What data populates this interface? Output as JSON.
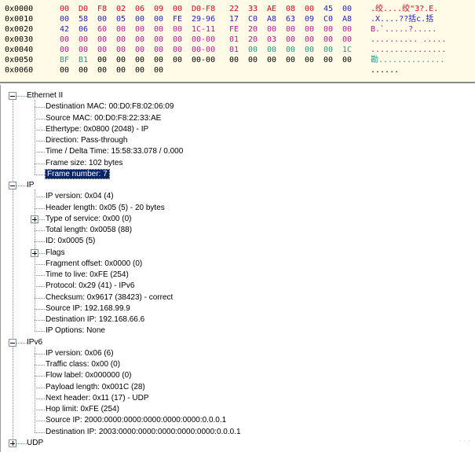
{
  "hex_view": {
    "rows": [
      {
        "offset": "0x0000",
        "bytes": [
          [
            "00",
            "#e0001b"
          ],
          [
            "D0",
            "#e0001b"
          ],
          [
            "F8",
            "#e0001b"
          ],
          [
            "02",
            "#e0001b"
          ],
          [
            "06",
            "#e0001b"
          ],
          [
            "09",
            "#e0001b"
          ],
          [
            "00",
            "#e0001b"
          ],
          [
            "D0-F8",
            "#e0001b"
          ],
          [
            "22",
            "#e0001b"
          ],
          [
            "33",
            "#e0001b"
          ],
          [
            "AE",
            "#e0001b"
          ],
          [
            "08",
            "#e0001b"
          ],
          [
            "00",
            "#e0001b"
          ],
          [
            "45",
            "#2020d0"
          ],
          [
            "00",
            "#2020d0"
          ]
        ],
        "ascii": ".绞....绞\"3?.E.",
        "ascii_color": "#e0001b"
      },
      {
        "offset": "0x0010",
        "bytes": [
          [
            "00",
            "#2020d0"
          ],
          [
            "58",
            "#2020d0"
          ],
          [
            "00",
            "#2020d0"
          ],
          [
            "05",
            "#2020d0"
          ],
          [
            "00",
            "#2020d0"
          ],
          [
            "00",
            "#2020d0"
          ],
          [
            "FE",
            "#2020d0"
          ],
          [
            "29-96",
            "#2020d0"
          ],
          [
            "17",
            "#2020d0"
          ],
          [
            "C0",
            "#2020d0"
          ],
          [
            "A8",
            "#2020d0"
          ],
          [
            "63",
            "#2020d0"
          ],
          [
            "09",
            "#2020d0"
          ],
          [
            "C0",
            "#2020d0"
          ],
          [
            "A8",
            "#2020d0"
          ]
        ],
        "ascii": ".X....??括c.括",
        "ascii_color": "#2020d0"
      },
      {
        "offset": "0x0020",
        "bytes": [
          [
            "42",
            "#2020d0"
          ],
          [
            "06",
            "#2020d0"
          ],
          [
            "60",
            "#c0129c"
          ],
          [
            "00",
            "#c0129c"
          ],
          [
            "00",
            "#c0129c"
          ],
          [
            "00",
            "#c0129c"
          ],
          [
            "00",
            "#c0129c"
          ],
          [
            "1C-11",
            "#c0129c"
          ],
          [
            "FE",
            "#c0129c"
          ],
          [
            "20",
            "#c0129c"
          ],
          [
            "00",
            "#c0129c"
          ],
          [
            "00",
            "#c0129c"
          ],
          [
            "00",
            "#c0129c"
          ],
          [
            "00",
            "#c0129c"
          ],
          [
            "00",
            "#c0129c"
          ]
        ],
        "ascii": "B.`.....?.....",
        "ascii_color": "#c0129c"
      },
      {
        "offset": "0x0030",
        "bytes": [
          [
            "00",
            "#c0129c"
          ],
          [
            "00",
            "#c0129c"
          ],
          [
            "00",
            "#c0129c"
          ],
          [
            "00",
            "#c0129c"
          ],
          [
            "00",
            "#c0129c"
          ],
          [
            "00",
            "#c0129c"
          ],
          [
            "00",
            "#c0129c"
          ],
          [
            "00-00",
            "#c0129c"
          ],
          [
            "01",
            "#c0129c"
          ],
          [
            "20",
            "#c0129c"
          ],
          [
            "03",
            "#c0129c"
          ],
          [
            "00",
            "#c0129c"
          ],
          [
            "00",
            "#c0129c"
          ],
          [
            "00",
            "#c0129c"
          ],
          [
            "00",
            "#c0129c"
          ]
        ],
        "ascii": ".......... .....",
        "ascii_color": "#c0129c"
      },
      {
        "offset": "0x0040",
        "bytes": [
          [
            "00",
            "#c0129c"
          ],
          [
            "00",
            "#c0129c"
          ],
          [
            "00",
            "#c0129c"
          ],
          [
            "00",
            "#c0129c"
          ],
          [
            "00",
            "#c0129c"
          ],
          [
            "00",
            "#c0129c"
          ],
          [
            "00",
            "#c0129c"
          ],
          [
            "00-00",
            "#c0129c"
          ],
          [
            "01",
            "#c0129c"
          ],
          [
            "00",
            "#1a9a8a"
          ],
          [
            "00",
            "#1a9a8a"
          ],
          [
            "00",
            "#1a9a8a"
          ],
          [
            "00",
            "#1a9a8a"
          ],
          [
            "00",
            "#1a9a8a"
          ],
          [
            "1C",
            "#1a9a8a"
          ]
        ],
        "ascii": "................",
        "ascii_color": "#c0129c"
      },
      {
        "offset": "0x0050",
        "bytes": [
          [
            "BF",
            "#1a9a8a"
          ],
          [
            "B1",
            "#1a9a8a"
          ],
          [
            "00",
            "#000000"
          ],
          [
            "00",
            "#000000"
          ],
          [
            "00",
            "#000000"
          ],
          [
            "00",
            "#000000"
          ],
          [
            "00",
            "#000000"
          ],
          [
            "00-00",
            "#000000"
          ],
          [
            "00",
            "#000000"
          ],
          [
            "00",
            "#000000"
          ],
          [
            "00",
            "#000000"
          ],
          [
            "00",
            "#000000"
          ],
          [
            "00",
            "#000000"
          ],
          [
            "00",
            "#000000"
          ],
          [
            "00",
            "#000000"
          ]
        ],
        "ascii": "勘..............",
        "ascii_color": "#1a9a8a"
      },
      {
        "offset": "0x0060",
        "bytes": [
          [
            "00",
            "#000000"
          ],
          [
            "00",
            "#000000"
          ],
          [
            "00",
            "#000000"
          ],
          [
            "00",
            "#000000"
          ],
          [
            "00",
            "#000000"
          ],
          [
            "00",
            "#000000"
          ]
        ],
        "ascii": "......",
        "ascii_color": "#000000"
      }
    ]
  },
  "tree": {
    "nodes": [
      {
        "label": "Ethernet II",
        "level": 0,
        "expander": "minus"
      },
      {
        "label": "Destination MAC: 00:D0:F8:02:06:09",
        "level": 1
      },
      {
        "label": "Source MAC: 00:D0:F8:22:33:AE",
        "level": 1
      },
      {
        "label": "Ethertype: 0x0800 (2048) - IP",
        "level": 1
      },
      {
        "label": "Direction: Pass-through",
        "level": 1
      },
      {
        "label": "Time / Delta Time: 15:58:33.078 / 0.000",
        "level": 1
      },
      {
        "label": "Frame size: 102 bytes",
        "level": 1
      },
      {
        "label": "Frame number: 7",
        "level": 1,
        "selected": true
      },
      {
        "label": "IP",
        "level": 0,
        "expander": "minus"
      },
      {
        "label": "IP version: 0x04 (4)",
        "level": 1
      },
      {
        "label": "Header length: 0x05 (5) - 20 bytes",
        "level": 1
      },
      {
        "label": "Type of service: 0x00 (0)",
        "level": 1,
        "expander": "plus"
      },
      {
        "label": "Total length: 0x0058 (88)",
        "level": 1
      },
      {
        "label": "ID: 0x0005 (5)",
        "level": 1
      },
      {
        "label": "Flags",
        "level": 1,
        "expander": "plus"
      },
      {
        "label": "Fragment offset: 0x0000 (0)",
        "level": 1
      },
      {
        "label": "Time to live: 0xFE (254)",
        "level": 1
      },
      {
        "label": "Protocol: 0x29 (41) - IPv6",
        "level": 1
      },
      {
        "label": "Checksum: 0x9617 (38423) - correct",
        "level": 1
      },
      {
        "label": "Source IP: 192.168.99.9",
        "level": 1
      },
      {
        "label": "Destination IP: 192.168.66.6",
        "level": 1
      },
      {
        "label": "IP Options: None",
        "level": 1
      },
      {
        "label": "IPv6",
        "level": 0,
        "expander": "minus"
      },
      {
        "label": "IP version: 0x06 (6)",
        "level": 1
      },
      {
        "label": "Traffic class: 0x00 (0)",
        "level": 1
      },
      {
        "label": "Flow label: 0x000000 (0)",
        "level": 1
      },
      {
        "label": "Payload length: 0x001C (28)",
        "level": 1
      },
      {
        "label": "Next header: 0x11 (17) - UDP",
        "level": 1
      },
      {
        "label": "Hop limit: 0xFE (254)",
        "level": 1
      },
      {
        "label": "Source IP: 2000:0000:0000:0000:0000:0000:0.0.0.1",
        "level": 1
      },
      {
        "label": "Destination IP: 2003:0000:0000:0000:0000:0000:0.0.0.1",
        "level": 1
      },
      {
        "label": "UDP",
        "level": 0,
        "expander": "plus"
      }
    ]
  },
  "watermark": "· · ·"
}
